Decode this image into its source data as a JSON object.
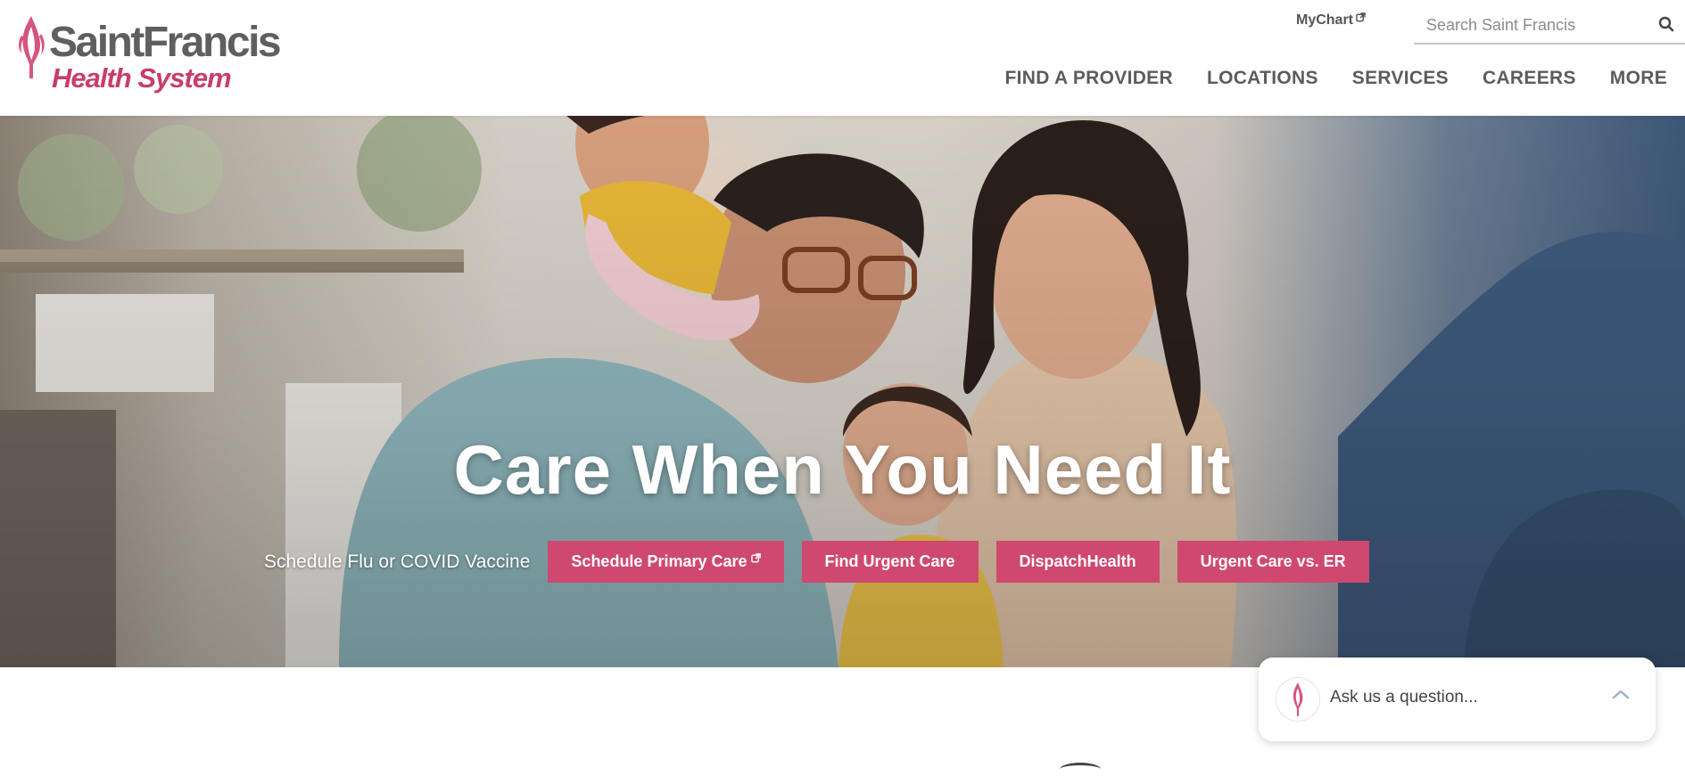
{
  "logo": {
    "line1": "SaintFrancis",
    "line2": "Health System"
  },
  "header": {
    "mychart_label": "MyChart",
    "search": {
      "placeholder": "Search Saint Francis",
      "value": ""
    },
    "nav": [
      "FIND A PROVIDER",
      "LOCATIONS",
      "SERVICES",
      "CAREERS",
      "MORE"
    ]
  },
  "hero": {
    "title": "Care When You Need It",
    "cta_label": "Schedule Flu or COVID Vaccine",
    "buttons": [
      "Schedule Primary Care",
      "Find Urgent Care",
      "DispatchHealth",
      "Urgent Care vs. ER"
    ]
  },
  "chat": {
    "prompt": "Ask us a question..."
  },
  "colors": {
    "brand_pink": "#cf4870",
    "logo_gray": "#5f5f5f",
    "nav_text": "#5c5c5c"
  },
  "icons": [
    "flame-logo-icon",
    "external-link-icon",
    "search-icon",
    "chevron-up-icon"
  ]
}
